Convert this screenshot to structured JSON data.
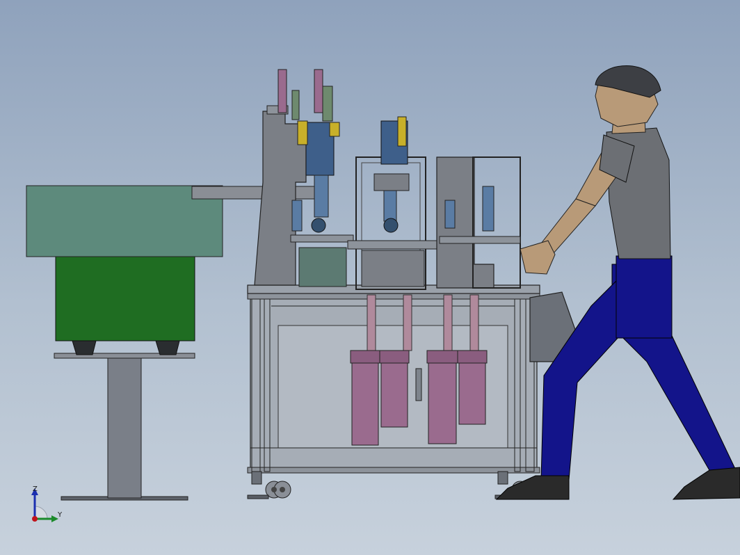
{
  "view": {
    "background_top": "#8fa2bc",
    "background_bottom": "#c7d1dc"
  },
  "triad": {
    "z_label": "Z",
    "y_label": "Y",
    "z_color": "#1b2fb0",
    "y_color": "#1b8a2b",
    "origin_color": "#c0141c"
  },
  "colors": {
    "bowl_feeder": "#5d8a7c",
    "bowl_base": "#1f6d22",
    "frame_steel": "#7b7f86",
    "cylinder": "#9a6b8e",
    "motor_blue": "#3e5f8a",
    "sensor_yellow": "#c8b02a",
    "operator_shirt": "#6c6f74",
    "operator_pants": "#13148a",
    "operator_skin": "#b89a78"
  }
}
